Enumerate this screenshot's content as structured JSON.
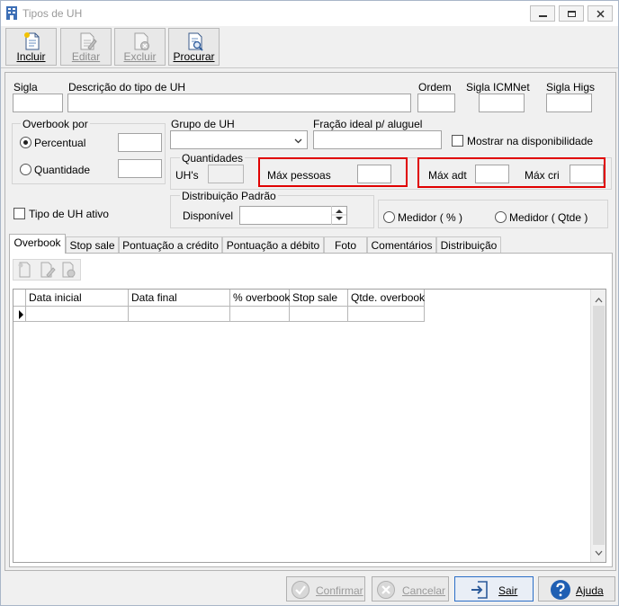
{
  "window": {
    "title": "Tipos de UH"
  },
  "toolbar": {
    "incluir": "Incluir",
    "editar": "Editar",
    "excluir": "Excluir",
    "procurar": "Procurar"
  },
  "fields": {
    "sigla": "Sigla",
    "descricao": "Descrição do tipo de UH",
    "ordem": "Ordem",
    "sigla_icmnet": "Sigla ICMNet",
    "sigla_higs": "Sigla Higs",
    "overbook_por": "Overbook por",
    "percentual": "Percentual",
    "quantidade": "Quantidade",
    "grupo_uh": "Grupo de UH",
    "fracao": "Fração ideal p/ aluguel",
    "mostrar": "Mostrar na disponibilidade",
    "quantidades": "Quantidades",
    "uhs": "UH's",
    "max_pessoas": "Máx pessoas",
    "max_adt": "Máx adt",
    "max_cri": "Máx cri",
    "distribuicao_padrao": "Distribuição Padrão",
    "disponivel": "Disponível",
    "tipo_uh_ativo": "Tipo de UH ativo",
    "medidor_pct": "Medidor ( % )",
    "medidor_qtde": "Medidor ( Qtde )"
  },
  "tabs": [
    "Overbook",
    "Stop sale",
    "Pontuação a crédito",
    "Pontuação a débito",
    "Foto",
    "Comentários",
    "Distribuição"
  ],
  "grid": {
    "columns": [
      "Data inicial",
      "Data final",
      "% overbook",
      "Stop sale",
      "Qtde. overbook"
    ]
  },
  "buttons": {
    "confirmar": "Confirmar",
    "cancelar": "Cancelar",
    "sair": "Sair",
    "ajuda": "Ajuda"
  },
  "colors": {
    "highlight": "#e00000",
    "accent": "#2c6fc7"
  }
}
